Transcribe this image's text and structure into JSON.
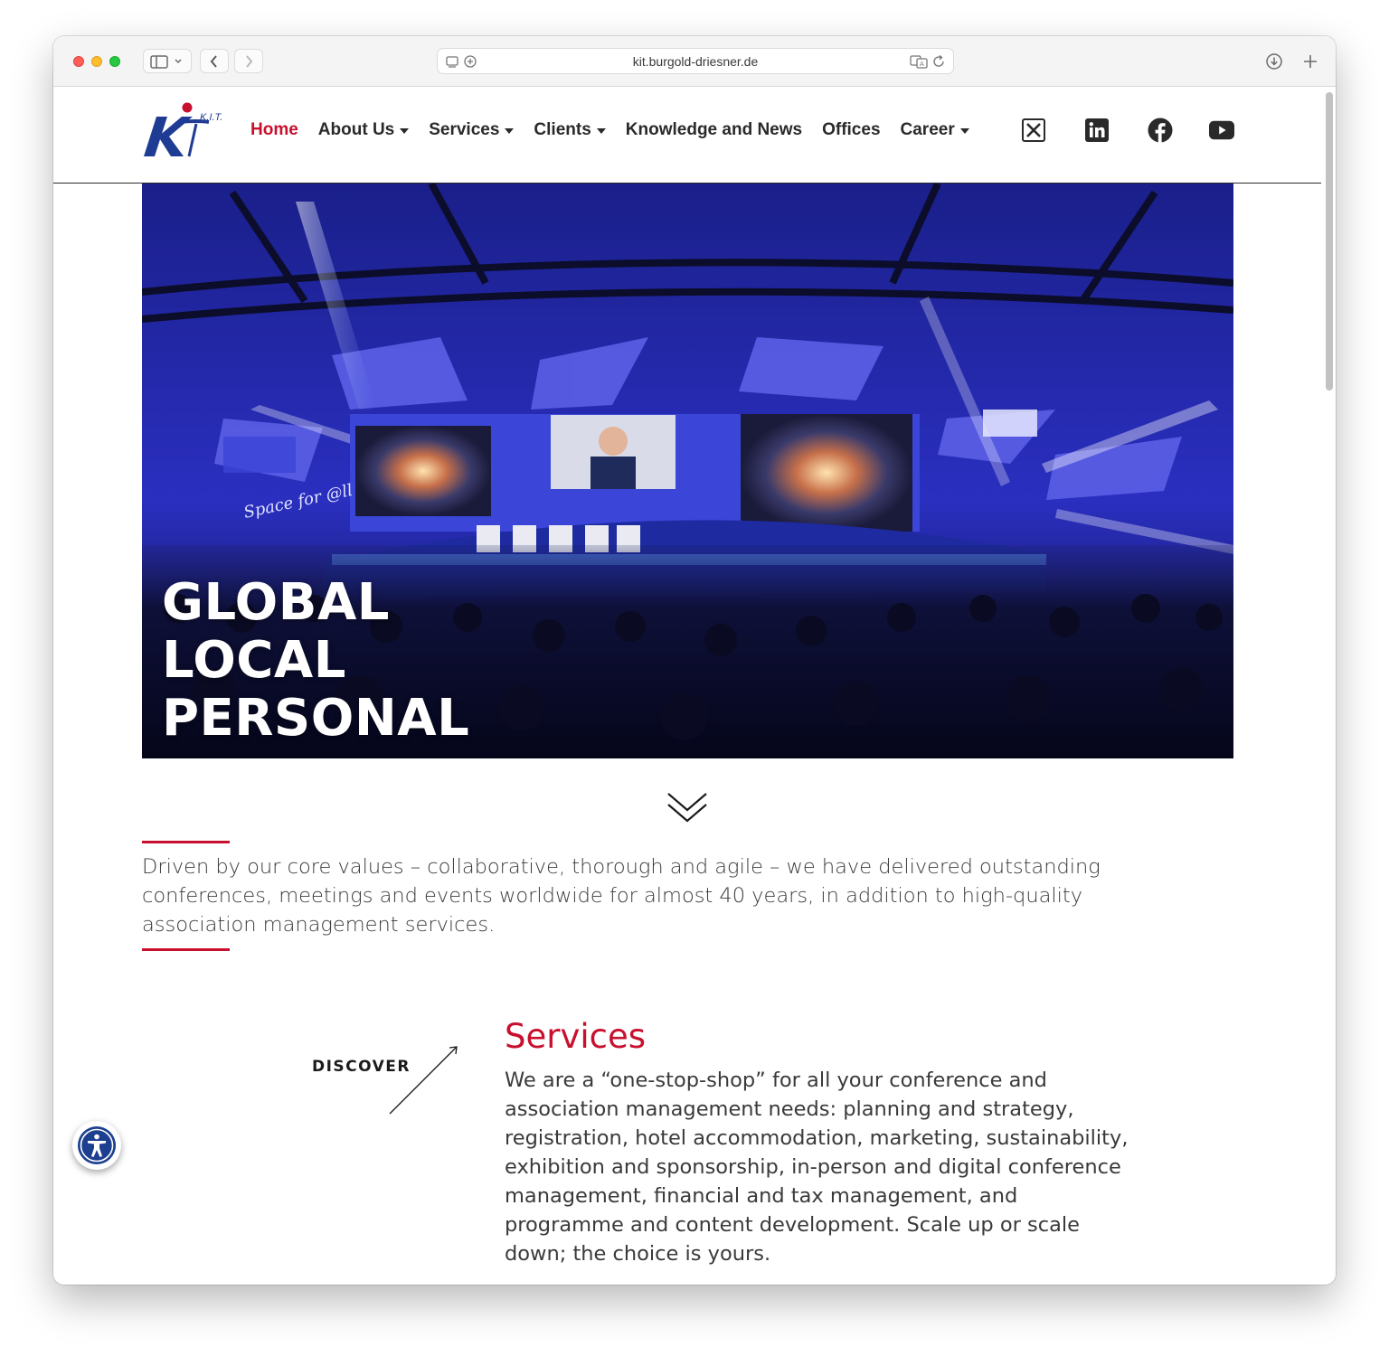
{
  "browser": {
    "url": "kit.burgold-driesner.de"
  },
  "logo": {
    "text": "K.I.T."
  },
  "nav": {
    "items": [
      {
        "label": "Home",
        "active": true,
        "dropdown": false
      },
      {
        "label": "About Us",
        "active": false,
        "dropdown": true
      },
      {
        "label": "Services",
        "active": false,
        "dropdown": true
      },
      {
        "label": "Clients",
        "active": false,
        "dropdown": true
      },
      {
        "label": "Knowledge and News",
        "active": false,
        "dropdown": false
      },
      {
        "label": "Offices",
        "active": false,
        "dropdown": false
      },
      {
        "label": "Career",
        "active": false,
        "dropdown": true
      }
    ],
    "social": [
      "x-icon",
      "linkedin-icon",
      "facebook-icon",
      "youtube-icon"
    ]
  },
  "hero": {
    "line1": "GLOBAL",
    "line2": "LOCAL",
    "line3": "PERSONAL",
    "stage_text": "Space for @ll"
  },
  "intro": {
    "text": "Driven by our core values – collaborative, thorough and agile – we have delivered outstanding conferences, meetings and events worldwide for almost 40 years, in addition to high-quality association management services."
  },
  "services": {
    "discover_label": "DISCOVER",
    "title": "Services",
    "text": "We are a “one-stop-shop” for all your conference and association management needs: planning and strategy, registration, hotel accommodation, marketing, sustainability, exhibition and sponsorship, in-person and digital conference management, financial and tax management, and programme and content development. Scale up or scale down; the choice is yours."
  },
  "colors": {
    "accent": "#c8102e",
    "text": "#3a3a3a",
    "logo_blue": "#1f3c94"
  }
}
